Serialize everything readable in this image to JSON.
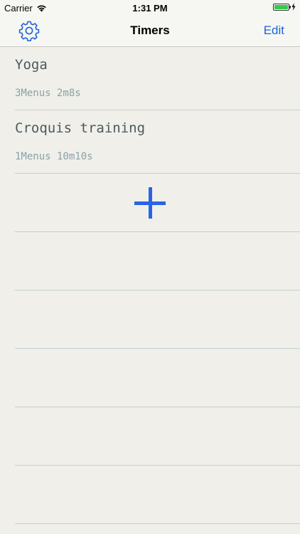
{
  "status_bar": {
    "carrier": "Carrier",
    "time": "1:31 PM",
    "battery_color": "#2fcc4a"
  },
  "nav": {
    "title": "Timers",
    "edit_label": "Edit",
    "settings_icon": "gear-icon",
    "accent_color": "#1f64d8"
  },
  "timers": [
    {
      "name": "Yoga",
      "detail": "3Menus 2m8s"
    },
    {
      "name": "Croquis training",
      "detail": "1Menus 10m10s"
    }
  ],
  "add_button": {
    "icon": "plus-icon",
    "color": "#2a63e8"
  }
}
